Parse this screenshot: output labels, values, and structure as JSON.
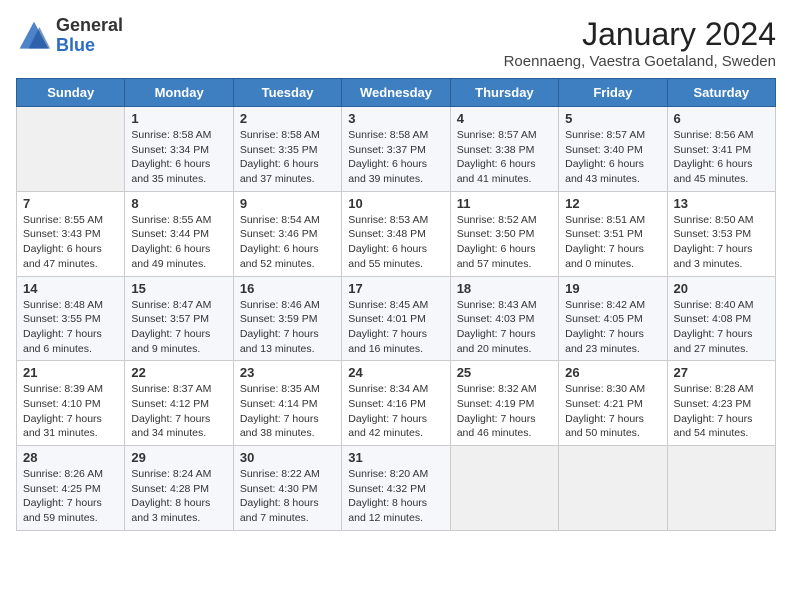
{
  "header": {
    "logo_general": "General",
    "logo_blue": "Blue",
    "month_year": "January 2024",
    "location": "Roennaeng, Vaestra Goetaland, Sweden"
  },
  "days_of_week": [
    "Sunday",
    "Monday",
    "Tuesday",
    "Wednesday",
    "Thursday",
    "Friday",
    "Saturday"
  ],
  "weeks": [
    [
      {
        "day": "",
        "info": ""
      },
      {
        "day": "1",
        "info": "Sunrise: 8:58 AM\nSunset: 3:34 PM\nDaylight: 6 hours\nand 35 minutes."
      },
      {
        "day": "2",
        "info": "Sunrise: 8:58 AM\nSunset: 3:35 PM\nDaylight: 6 hours\nand 37 minutes."
      },
      {
        "day": "3",
        "info": "Sunrise: 8:58 AM\nSunset: 3:37 PM\nDaylight: 6 hours\nand 39 minutes."
      },
      {
        "day": "4",
        "info": "Sunrise: 8:57 AM\nSunset: 3:38 PM\nDaylight: 6 hours\nand 41 minutes."
      },
      {
        "day": "5",
        "info": "Sunrise: 8:57 AM\nSunset: 3:40 PM\nDaylight: 6 hours\nand 43 minutes."
      },
      {
        "day": "6",
        "info": "Sunrise: 8:56 AM\nSunset: 3:41 PM\nDaylight: 6 hours\nand 45 minutes."
      }
    ],
    [
      {
        "day": "7",
        "info": "Sunrise: 8:55 AM\nSunset: 3:43 PM\nDaylight: 6 hours\nand 47 minutes."
      },
      {
        "day": "8",
        "info": "Sunrise: 8:55 AM\nSunset: 3:44 PM\nDaylight: 6 hours\nand 49 minutes."
      },
      {
        "day": "9",
        "info": "Sunrise: 8:54 AM\nSunset: 3:46 PM\nDaylight: 6 hours\nand 52 minutes."
      },
      {
        "day": "10",
        "info": "Sunrise: 8:53 AM\nSunset: 3:48 PM\nDaylight: 6 hours\nand 55 minutes."
      },
      {
        "day": "11",
        "info": "Sunrise: 8:52 AM\nSunset: 3:50 PM\nDaylight: 6 hours\nand 57 minutes."
      },
      {
        "day": "12",
        "info": "Sunrise: 8:51 AM\nSunset: 3:51 PM\nDaylight: 7 hours\nand 0 minutes."
      },
      {
        "day": "13",
        "info": "Sunrise: 8:50 AM\nSunset: 3:53 PM\nDaylight: 7 hours\nand 3 minutes."
      }
    ],
    [
      {
        "day": "14",
        "info": "Sunrise: 8:48 AM\nSunset: 3:55 PM\nDaylight: 7 hours\nand 6 minutes."
      },
      {
        "day": "15",
        "info": "Sunrise: 8:47 AM\nSunset: 3:57 PM\nDaylight: 7 hours\nand 9 minutes."
      },
      {
        "day": "16",
        "info": "Sunrise: 8:46 AM\nSunset: 3:59 PM\nDaylight: 7 hours\nand 13 minutes."
      },
      {
        "day": "17",
        "info": "Sunrise: 8:45 AM\nSunset: 4:01 PM\nDaylight: 7 hours\nand 16 minutes."
      },
      {
        "day": "18",
        "info": "Sunrise: 8:43 AM\nSunset: 4:03 PM\nDaylight: 7 hours\nand 20 minutes."
      },
      {
        "day": "19",
        "info": "Sunrise: 8:42 AM\nSunset: 4:05 PM\nDaylight: 7 hours\nand 23 minutes."
      },
      {
        "day": "20",
        "info": "Sunrise: 8:40 AM\nSunset: 4:08 PM\nDaylight: 7 hours\nand 27 minutes."
      }
    ],
    [
      {
        "day": "21",
        "info": "Sunrise: 8:39 AM\nSunset: 4:10 PM\nDaylight: 7 hours\nand 31 minutes."
      },
      {
        "day": "22",
        "info": "Sunrise: 8:37 AM\nSunset: 4:12 PM\nDaylight: 7 hours\nand 34 minutes."
      },
      {
        "day": "23",
        "info": "Sunrise: 8:35 AM\nSunset: 4:14 PM\nDaylight: 7 hours\nand 38 minutes."
      },
      {
        "day": "24",
        "info": "Sunrise: 8:34 AM\nSunset: 4:16 PM\nDaylight: 7 hours\nand 42 minutes."
      },
      {
        "day": "25",
        "info": "Sunrise: 8:32 AM\nSunset: 4:19 PM\nDaylight: 7 hours\nand 46 minutes."
      },
      {
        "day": "26",
        "info": "Sunrise: 8:30 AM\nSunset: 4:21 PM\nDaylight: 7 hours\nand 50 minutes."
      },
      {
        "day": "27",
        "info": "Sunrise: 8:28 AM\nSunset: 4:23 PM\nDaylight: 7 hours\nand 54 minutes."
      }
    ],
    [
      {
        "day": "28",
        "info": "Sunrise: 8:26 AM\nSunset: 4:25 PM\nDaylight: 7 hours\nand 59 minutes."
      },
      {
        "day": "29",
        "info": "Sunrise: 8:24 AM\nSunset: 4:28 PM\nDaylight: 8 hours\nand 3 minutes."
      },
      {
        "day": "30",
        "info": "Sunrise: 8:22 AM\nSunset: 4:30 PM\nDaylight: 8 hours\nand 7 minutes."
      },
      {
        "day": "31",
        "info": "Sunrise: 8:20 AM\nSunset: 4:32 PM\nDaylight: 8 hours\nand 12 minutes."
      },
      {
        "day": "",
        "info": ""
      },
      {
        "day": "",
        "info": ""
      },
      {
        "day": "",
        "info": ""
      }
    ]
  ]
}
